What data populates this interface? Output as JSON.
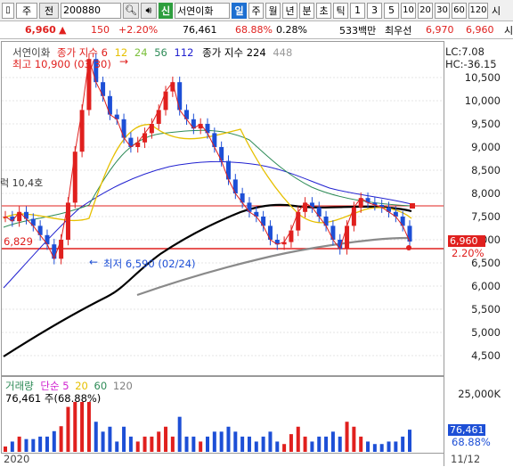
{
  "toolbar": {
    "market": "주",
    "prev": "전",
    "code": "200880",
    "new_badge": "신",
    "stock_name": "서연이화",
    "periods": [
      "일",
      "주",
      "월",
      "년",
      "분",
      "초",
      "틱"
    ],
    "active_period": "일",
    "intervals": [
      "1",
      "3",
      "5",
      "10",
      "20",
      "30",
      "60",
      "120"
    ],
    "right_cut": "시"
  },
  "quote": {
    "price": "6,960",
    "change_arrow": "▲",
    "change": "150",
    "change_pct": "+2.20%",
    "volume": "76,461",
    "vol_ratio": "68.88%",
    "turnover": "0.28%",
    "amount": "533백만",
    "best_ask_label": "최우선",
    "ask": "6,970",
    "bid": "6,960",
    "right_cut": "시"
  },
  "price_panel": {
    "legend_name": "서연이화",
    "ma_label": "종가 지수",
    "ma_periods": [
      "6",
      "12",
      "24",
      "56",
      "112"
    ],
    "ma_colors": [
      "#e0201e",
      "#e6c000",
      "#7cc03c",
      "#2e8b57",
      "#2020d0"
    ],
    "ma2_label": "종가 지수 224",
    "ma2_extra": "448",
    "lc": "LC:7.08",
    "hc": "HC:-36.15",
    "high_label": "최고 10,900 (03/30)",
    "low_label": "최저 6,590 (02/24)",
    "left_level": "6,829",
    "left_cut": "럭 10,4호",
    "price_tag": "6,960",
    "pct_tag": "2.20%",
    "y_ticks": [
      "10,500",
      "10,000",
      "9,500",
      "9,000",
      "8,500",
      "8,000",
      "7,500",
      "7,000",
      "6,500",
      "6,000",
      "5,500",
      "5,000",
      "4,500"
    ]
  },
  "volume_panel": {
    "legend_label": "거래량",
    "ma_kind": "단순",
    "periods": [
      "5",
      "20",
      "60",
      "120"
    ],
    "period_colors": [
      "#d020d0",
      "#e6c000",
      "#2e8b57",
      "#808080"
    ],
    "current": "76,461 주(68.88%)",
    "y_tick": "25,000K",
    "vol_tag": "76,461",
    "pct_tag": "68.88%"
  },
  "xaxis": {
    "left": "2020",
    "right": "11/12"
  },
  "chart_data": {
    "type": "line",
    "title": "서연이화",
    "ylim": [
      4200,
      11000
    ],
    "series": [
      {
        "name": "close",
        "values": [
          7500,
          7400,
          7600,
          7450,
          7300,
          7100,
          6900,
          6590,
          7000,
          7800,
          8900,
          9800,
          10900,
          10400,
          10100,
          9700,
          9600,
          9200,
          9000,
          9100,
          9300,
          9500,
          9800,
          10200,
          10400,
          9800,
          9600,
          9400,
          9500,
          9300,
          9000,
          8700,
          8300,
          8000,
          7800,
          7600,
          7500,
          7300,
          7000,
          6900,
          6950,
          7200,
          7600,
          7800,
          7700,
          7500,
          7300,
          7000,
          6800,
          7300,
          7700,
          7900,
          7800,
          7750,
          7700,
          7600,
          7500,
          7300,
          6960
        ]
      }
    ]
  }
}
